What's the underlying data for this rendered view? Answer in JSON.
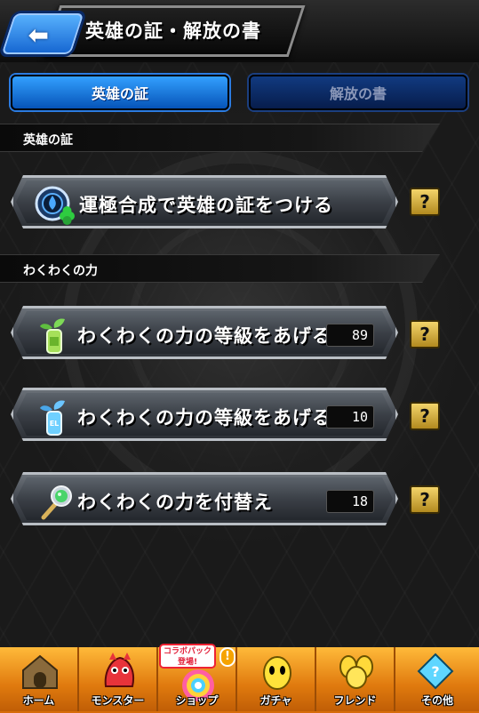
{
  "header": {
    "title": "英雄の証・解放の書",
    "back_icon": "back-arrow-icon"
  },
  "tabs": [
    {
      "label": "英雄の証",
      "active": true
    },
    {
      "label": "解放の書",
      "active": false
    }
  ],
  "sections": [
    {
      "label": "英雄の証"
    },
    {
      "label": "わくわくの力"
    }
  ],
  "menu": [
    {
      "label": "運極合成で英雄の証をつける",
      "icon": "hero-badge-clover-icon",
      "count": null
    },
    {
      "label": "わくわくの力の等級をあげる",
      "icon": "green-sprout-bottle-icon",
      "count": "89"
    },
    {
      "label": "わくわくの力の等級をあげる",
      "icon": "el-blue-sprout-bottle-icon",
      "count": "10"
    },
    {
      "label": "わくわくの力を付替え",
      "icon": "green-orb-wand-icon",
      "count": "18"
    }
  ],
  "help_label": "?",
  "bottom_nav": [
    {
      "label": "ホーム",
      "icon": "home-icon"
    },
    {
      "label": "モンスター",
      "icon": "monster-icon"
    },
    {
      "label": "ショップ",
      "icon": "shop-icon"
    },
    {
      "label": "ガチャ",
      "icon": "gacha-egg-icon"
    },
    {
      "label": "フレンド",
      "icon": "friends-icon"
    },
    {
      "label": "その他",
      "icon": "other-menu-icon"
    }
  ],
  "promo_badge": {
    "line1": "コラボパック",
    "line2": "登場!"
  },
  "alert_mark": "!",
  "colors": {
    "active_tab": "#1a7fe6",
    "inactive_tab": "#0b2b66",
    "help_button": "#d8b340",
    "nav_bar": "#f09b1e"
  }
}
